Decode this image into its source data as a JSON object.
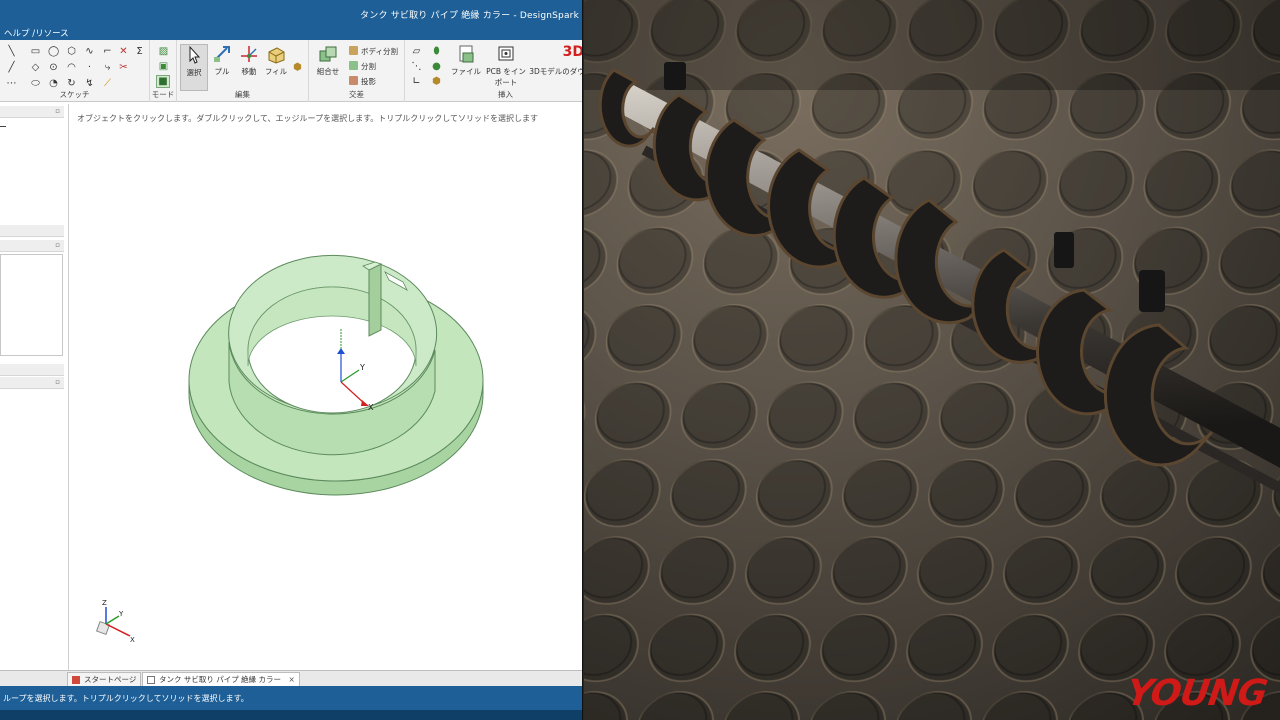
{
  "cad": {
    "title": "タンク サビ取り パイプ 絶縁 カラー - DesignSpark",
    "menu": "ヘルプ /リソース",
    "ribbon": {
      "groups": {
        "sketch": "スケッチ",
        "mode": "モード",
        "edit": "編集",
        "intersect": "交差",
        "insert": "挿入"
      },
      "buttons": {
        "select": "選択",
        "pull": "プル",
        "move": "移動",
        "fill": "フィル",
        "combine": "組合せ",
        "split_body": "ボディ分割",
        "split": "分割",
        "project": "投影",
        "file": "ファイル",
        "pcb_import_line1": "PCB をイン",
        "pcb_import_line2": "ポート",
        "model_3d": "3Dモデルのダウ",
        "badge_3d": "3D"
      }
    },
    "hint": "オブジェクトをクリックします。ダブルクリックして、エッジループを選択します。トリプルクリックしてソリッドを選択します",
    "tabs": [
      {
        "label": "スタートページ"
      },
      {
        "label": "タンク  サビ取り  パイプ  絶縁  カラー",
        "close": "×"
      }
    ],
    "status": "ループを選択します。トリプルクリックしてソリッドを選択します。",
    "axis_labels": {
      "x": "X",
      "y": "Y",
      "z": "Z"
    }
  },
  "photo": {
    "watermark": "YOUNG"
  },
  "colors": {
    "title_bar": "#1d5f96",
    "model_face": "#bfe3b9",
    "model_edge": "#5c8a5c",
    "mat_rubber": "#3b3731",
    "collar_black": "#1c1c1c",
    "rod_metal": "#9a9590",
    "watermark": "#cf1a17"
  }
}
